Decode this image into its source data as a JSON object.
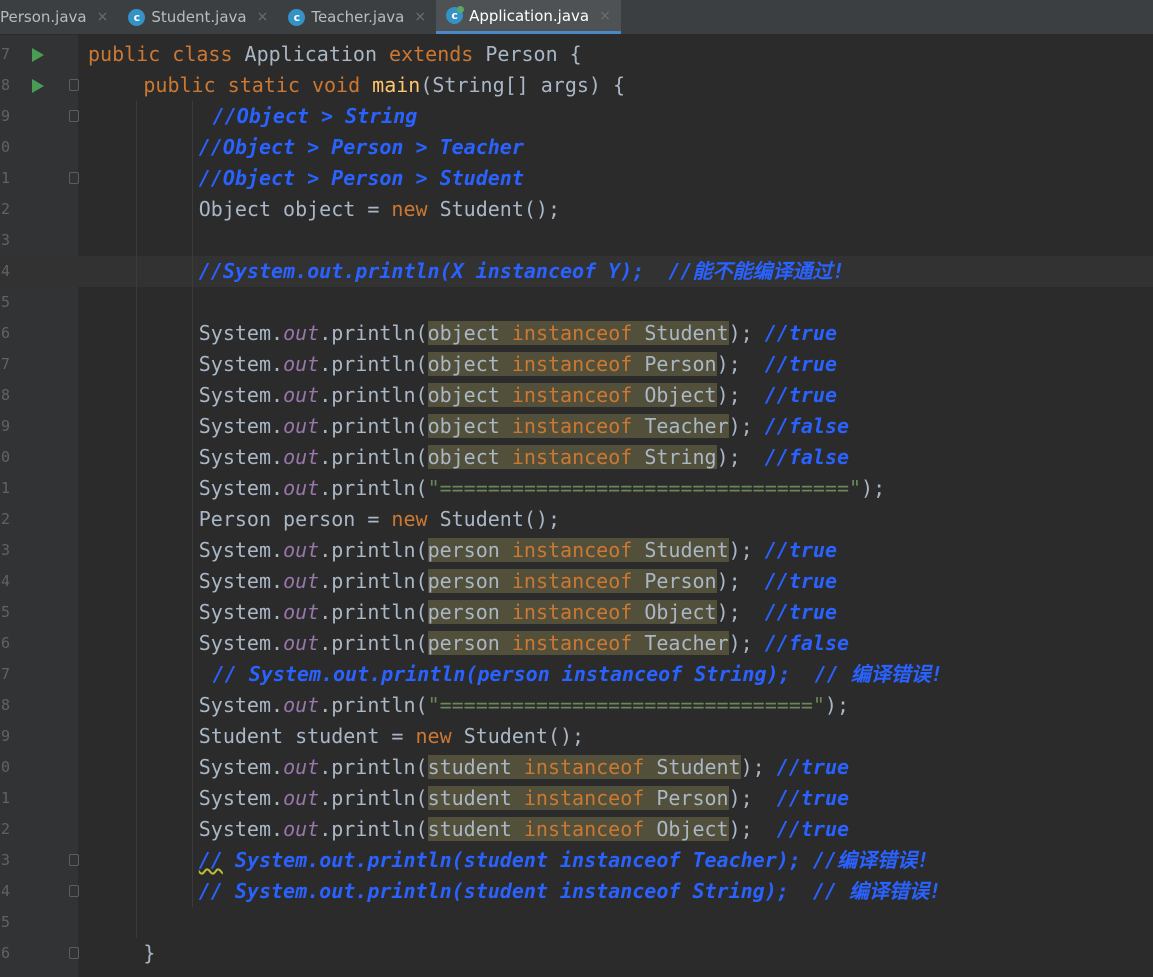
{
  "tabs": [
    {
      "label": "Person.java",
      "active": false,
      "icon": "class-icon"
    },
    {
      "label": "Student.java",
      "active": false,
      "icon": "class-icon"
    },
    {
      "label": "Teacher.java",
      "active": false,
      "icon": "class-icon"
    },
    {
      "label": "Application.java",
      "active": true,
      "icon": "main-class-icon"
    }
  ],
  "tab_close_glyph": "×",
  "class_icon_glyph": "c",
  "lines": [
    {
      "ln": "7",
      "run": true,
      "fold": false,
      "indent": 0,
      "tokens": [
        [
          "kw",
          "public class "
        ],
        [
          "",
          "Application "
        ],
        [
          "kw",
          "extends "
        ],
        [
          "",
          "Person {"
        ]
      ]
    },
    {
      "ln": "8",
      "run": true,
      "fold": true,
      "indent": 1,
      "tokens": [
        [
          "kw",
          "public static void "
        ],
        [
          "fn",
          "main"
        ],
        [
          "",
          "(String[] args) {"
        ]
      ]
    },
    {
      "ln": "9",
      "fold": true,
      "indent": 2,
      "pad": 1,
      "tokens": [
        [
          "cm",
          "//Object > String"
        ]
      ]
    },
    {
      "ln": "0",
      "indent": 2,
      "tokens": [
        [
          "cm",
          "//Object > Person > Teacher"
        ]
      ]
    },
    {
      "ln": "1",
      "fold": true,
      "indent": 2,
      "tokens": [
        [
          "cm",
          "//Object > Person > Student"
        ]
      ]
    },
    {
      "ln": "2",
      "indent": 2,
      "tokens": [
        [
          "",
          "Object object = "
        ],
        [
          "kw",
          "new "
        ],
        [
          "",
          "Student();"
        ]
      ]
    },
    {
      "ln": "3",
      "indent": 2,
      "tokens": []
    },
    {
      "ln": "4",
      "indent": 2,
      "current": true,
      "tokens": [
        [
          "cm",
          "//System.out.println(X instanceof Y);  //能不能编译通过!"
        ]
      ]
    },
    {
      "ln": "5",
      "indent": 2,
      "tokens": []
    },
    {
      "ln": "6",
      "indent": 2,
      "tokens": [
        [
          "",
          "System."
        ],
        [
          "st",
          "out"
        ],
        [
          "",
          ".println("
        ],
        [
          "hl",
          "object "
        ],
        [
          "hlkw",
          "instanceof"
        ],
        [
          "hl",
          " Student"
        ],
        [
          "",
          ");"
        ],
        [
          "cm",
          " //true"
        ]
      ]
    },
    {
      "ln": "7",
      "indent": 2,
      "tokens": [
        [
          "",
          "System."
        ],
        [
          "st",
          "out"
        ],
        [
          "",
          ".println("
        ],
        [
          "hl",
          "object "
        ],
        [
          "hlkw",
          "instanceof"
        ],
        [
          "hl",
          " Person"
        ],
        [
          "",
          ");  "
        ],
        [
          "cm",
          "//true"
        ]
      ]
    },
    {
      "ln": "8",
      "indent": 2,
      "tokens": [
        [
          "",
          "System."
        ],
        [
          "st",
          "out"
        ],
        [
          "",
          ".println("
        ],
        [
          "hl",
          "object "
        ],
        [
          "hlkw",
          "instanceof"
        ],
        [
          "hl",
          " Object"
        ],
        [
          "",
          ");  "
        ],
        [
          "cm",
          "//true"
        ]
      ]
    },
    {
      "ln": "9",
      "indent": 2,
      "tokens": [
        [
          "",
          "System."
        ],
        [
          "st",
          "out"
        ],
        [
          "",
          ".println("
        ],
        [
          "hl",
          "object "
        ],
        [
          "hlkw",
          "instanceof"
        ],
        [
          "hl",
          " Teacher"
        ],
        [
          "",
          ");"
        ],
        [
          "cm",
          " //false"
        ]
      ]
    },
    {
      "ln": "0",
      "indent": 2,
      "tokens": [
        [
          "",
          "System."
        ],
        [
          "st",
          "out"
        ],
        [
          "",
          ".println("
        ],
        [
          "hl",
          "object "
        ],
        [
          "hlkw",
          "instanceof"
        ],
        [
          "hl",
          " String"
        ],
        [
          "",
          ");  "
        ],
        [
          "cm",
          "//false"
        ]
      ]
    },
    {
      "ln": "1",
      "indent": 2,
      "tokens": [
        [
          "",
          "System."
        ],
        [
          "st",
          "out"
        ],
        [
          "",
          ".println("
        ],
        [
          "str",
          "\"==================================\""
        ],
        [
          "",
          ");"
        ]
      ]
    },
    {
      "ln": "2",
      "indent": 2,
      "tokens": [
        [
          "",
          "Person person = "
        ],
        [
          "kw",
          "new "
        ],
        [
          "",
          "Student();"
        ]
      ]
    },
    {
      "ln": "3",
      "indent": 2,
      "tokens": [
        [
          "",
          "System."
        ],
        [
          "st",
          "out"
        ],
        [
          "",
          ".println("
        ],
        [
          "hl",
          "person "
        ],
        [
          "hlkw",
          "instanceof"
        ],
        [
          "hl",
          " Student"
        ],
        [
          "",
          ");"
        ],
        [
          "cm",
          " //true"
        ]
      ]
    },
    {
      "ln": "4",
      "indent": 2,
      "tokens": [
        [
          "",
          "System."
        ],
        [
          "st",
          "out"
        ],
        [
          "",
          ".println("
        ],
        [
          "hl",
          "person "
        ],
        [
          "hlkw",
          "instanceof"
        ],
        [
          "hl",
          " Person"
        ],
        [
          "",
          ");  "
        ],
        [
          "cm",
          "//true"
        ]
      ]
    },
    {
      "ln": "5",
      "indent": 2,
      "tokens": [
        [
          "",
          "System."
        ],
        [
          "st",
          "out"
        ],
        [
          "",
          ".println("
        ],
        [
          "hl",
          "person "
        ],
        [
          "hlkw",
          "instanceof"
        ],
        [
          "hl",
          " Object"
        ],
        [
          "",
          ");  "
        ],
        [
          "cm",
          "//true"
        ]
      ]
    },
    {
      "ln": "6",
      "indent": 2,
      "tokens": [
        [
          "",
          "System."
        ],
        [
          "st",
          "out"
        ],
        [
          "",
          ".println("
        ],
        [
          "hl",
          "person "
        ],
        [
          "hlkw",
          "instanceof"
        ],
        [
          "hl",
          " Teacher"
        ],
        [
          "",
          ");"
        ],
        [
          "cm",
          " //false"
        ]
      ]
    },
    {
      "ln": "7",
      "indent": 2,
      "pad": 1,
      "tokens": [
        [
          "cm",
          "// System.out.println(person instanceof String);  // 编译错误!"
        ]
      ]
    },
    {
      "ln": "8",
      "indent": 2,
      "tokens": [
        [
          "",
          "System."
        ],
        [
          "st",
          "out"
        ],
        [
          "",
          ".println("
        ],
        [
          "str",
          "\"===============================\""
        ],
        [
          "",
          ");"
        ]
      ]
    },
    {
      "ln": "9",
      "indent": 2,
      "tokens": [
        [
          "",
          "Student student = "
        ],
        [
          "kw",
          "new "
        ],
        [
          "",
          "Student();"
        ]
      ]
    },
    {
      "ln": "0",
      "indent": 2,
      "tokens": [
        [
          "",
          "System."
        ],
        [
          "st",
          "out"
        ],
        [
          "",
          ".println("
        ],
        [
          "hl",
          "student "
        ],
        [
          "hlkw",
          "instanceof"
        ],
        [
          "hl",
          " Student"
        ],
        [
          "",
          ");"
        ],
        [
          "cm",
          " //true"
        ]
      ]
    },
    {
      "ln": "1",
      "indent": 2,
      "tokens": [
        [
          "",
          "System."
        ],
        [
          "st",
          "out"
        ],
        [
          "",
          ".println("
        ],
        [
          "hl",
          "student "
        ],
        [
          "hlkw",
          "instanceof"
        ],
        [
          "hl",
          " Person"
        ],
        [
          "",
          ");  "
        ],
        [
          "cm",
          "//true"
        ]
      ]
    },
    {
      "ln": "2",
      "indent": 2,
      "tokens": [
        [
          "",
          "System."
        ],
        [
          "st",
          "out"
        ],
        [
          "",
          ".println("
        ],
        [
          "hl",
          "student "
        ],
        [
          "hlkw",
          "instanceof"
        ],
        [
          "hl",
          " Object"
        ],
        [
          "",
          ");  "
        ],
        [
          "cm",
          "//true"
        ]
      ]
    },
    {
      "ln": "3",
      "fold": true,
      "indent": 2,
      "tokens": [
        [
          "cmsq",
          "//"
        ],
        [
          "cm",
          " System.out.println(student instanceof Teacher); //编译错误!"
        ]
      ]
    },
    {
      "ln": "4",
      "fold": true,
      "indent": 2,
      "tokens": [
        [
          "cm",
          "// System.out.println(student instanceof String);  // 编译错误!"
        ]
      ]
    },
    {
      "ln": "5",
      "indent": 2,
      "tokens": []
    },
    {
      "ln": "6",
      "fold": true,
      "indent": 1,
      "tokens": [
        [
          "",
          "}"
        ]
      ]
    }
  ]
}
